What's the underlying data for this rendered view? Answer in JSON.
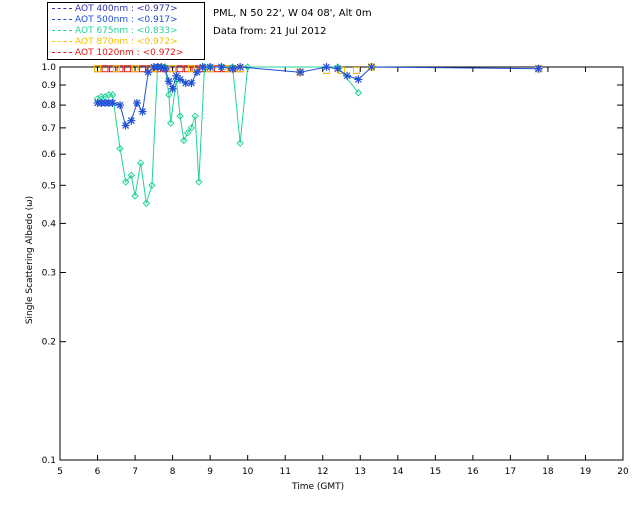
{
  "header": {
    "site": "PML, N 50 22', W 04 08', Alt 0m",
    "date": "Data from: 21 Jul 2012"
  },
  "legend": [
    {
      "label": "AOT  400nm : <0.977>",
      "color": "#3333aa"
    },
    {
      "label": "AOT  500nm : <0.917>",
      "color": "#1f4fd6"
    },
    {
      "label": "AOT  675nm : <0.833>",
      "color": "#22d39a"
    },
    {
      "label": "AOT  870nm : <0.972>",
      "color": "#f2c200"
    },
    {
      "label": "AOT 1020nm : <0.972>",
      "color": "#e01818"
    }
  ],
  "chart_data": {
    "type": "line",
    "title": "",
    "xlabel": "Time (GMT)",
    "ylabel": "Single Scattering Albedo (ω)",
    "xlim": [
      5,
      20
    ],
    "ylim": [
      0.1,
      1.0
    ],
    "yscale": "log",
    "x_ticks": [
      "5",
      "6",
      "7",
      "8",
      "9",
      "10",
      "11",
      "12",
      "13",
      "14",
      "15",
      "16",
      "17",
      "18",
      "19",
      "20"
    ],
    "y_ticks": [
      "0.1",
      "0.2",
      "0.3",
      "0.4",
      "0.5",
      "0.6",
      "0.7",
      "0.8",
      "0.9",
      "1.0"
    ],
    "series": [
      {
        "name": "AOT  400nm",
        "color": "#3333aa",
        "marker": "none",
        "x": [
          6.0,
          9.8,
          12.2,
          13.0
        ],
        "y": [
          1.0,
          1.0,
          1.0,
          1.0
        ]
      },
      {
        "name": "AOT  500nm",
        "color": "#1f4fd6",
        "marker": "asterisk",
        "x": [
          6.0,
          6.1,
          6.2,
          6.3,
          6.4,
          6.6,
          6.75,
          6.9,
          7.05,
          7.2,
          7.35,
          7.5,
          7.6,
          7.7,
          7.8,
          7.9,
          8.0,
          8.1,
          8.2,
          8.35,
          8.5,
          8.65,
          8.8,
          9.0,
          9.3,
          9.6,
          9.8,
          11.4,
          12.1,
          12.4,
          12.65,
          12.95,
          13.3,
          17.75
        ],
        "y": [
          0.81,
          0.81,
          0.81,
          0.81,
          0.81,
          0.8,
          0.71,
          0.73,
          0.81,
          0.77,
          0.97,
          1.0,
          1.0,
          1.0,
          0.99,
          0.92,
          0.88,
          0.95,
          0.93,
          0.91,
          0.91,
          0.97,
          1.0,
          1.0,
          1.0,
          0.99,
          1.0,
          0.97,
          1.0,
          0.99,
          0.95,
          0.93,
          1.0,
          0.99
        ]
      },
      {
        "name": "AOT  675nm",
        "color": "#22d39a",
        "marker": "diamond",
        "x": [
          6.0,
          6.1,
          6.2,
          6.3,
          6.4,
          6.6,
          6.75,
          6.9,
          7.0,
          7.15,
          7.3,
          7.45,
          7.6,
          7.7,
          7.8,
          7.9,
          7.95,
          8.1,
          8.2,
          8.3,
          8.4,
          8.5,
          8.6,
          8.7,
          8.85,
          9.0,
          9.3,
          9.6,
          9.8,
          10.0,
          12.4,
          12.95
        ],
        "y": [
          0.83,
          0.84,
          0.84,
          0.85,
          0.85,
          0.62,
          0.51,
          0.53,
          0.47,
          0.57,
          0.45,
          0.5,
          1.0,
          1.0,
          1.0,
          0.85,
          0.72,
          0.93,
          0.75,
          0.65,
          0.68,
          0.7,
          0.75,
          0.51,
          1.0,
          1.0,
          1.0,
          1.0,
          0.64,
          1.0,
          1.0,
          0.86
        ]
      },
      {
        "name": "AOT  870nm",
        "color": "#f2c200",
        "marker": "square",
        "x": [
          6.0,
          6.5,
          7.0,
          7.5,
          8.0,
          8.5,
          9.0,
          9.5,
          9.8,
          11.4,
          12.1,
          12.5,
          12.9,
          13.3,
          17.75
        ],
        "y": [
          0.99,
          0.99,
          0.99,
          0.99,
          0.99,
          0.99,
          0.99,
          0.99,
          0.99,
          0.97,
          0.98,
          0.98,
          0.98,
          1.0,
          0.99
        ]
      },
      {
        "name": "AOT 1020nm",
        "color": "#e01818",
        "marker": "square",
        "x": [
          6.0,
          6.2,
          6.4,
          6.6,
          6.8,
          7.0,
          7.2,
          7.4,
          7.6,
          7.8,
          8.0,
          8.2,
          8.4,
          8.6,
          8.8,
          9.0,
          9.2,
          9.4,
          9.6,
          9.8,
          11.4,
          12.1,
          12.5,
          12.9,
          13.3,
          17.75
        ],
        "y": [
          0.99,
          0.99,
          0.99,
          0.99,
          0.99,
          0.99,
          0.99,
          0.99,
          0.99,
          0.99,
          0.99,
          0.99,
          0.99,
          0.99,
          0.99,
          0.99,
          0.99,
          0.99,
          0.99,
          0.99,
          0.97,
          0.98,
          0.98,
          0.98,
          1.0,
          0.99
        ]
      }
    ]
  }
}
